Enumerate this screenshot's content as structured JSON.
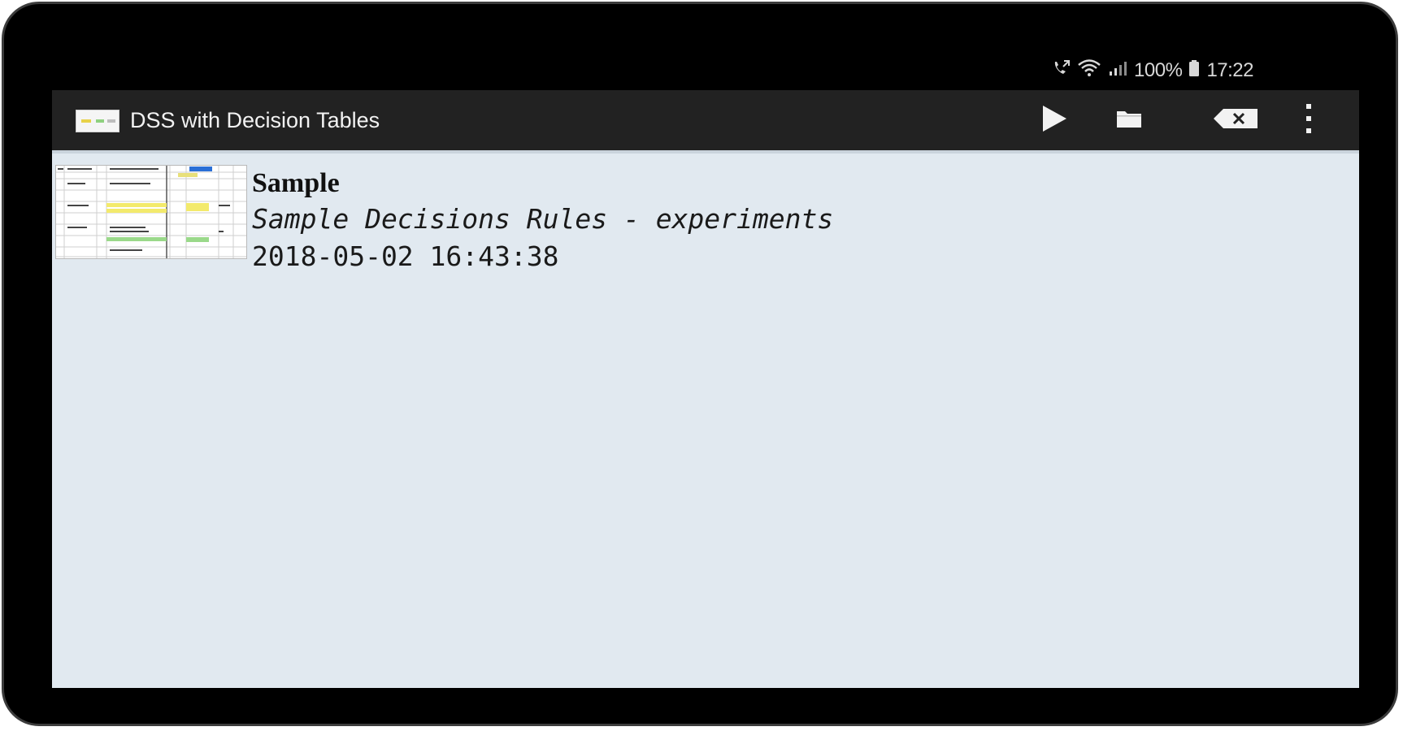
{
  "status_bar": {
    "battery_text": "100%",
    "time": "17:22",
    "icons": [
      "call-forwarding-icon",
      "wifi-icon",
      "signal-icon",
      "battery-icon"
    ]
  },
  "app_bar": {
    "title": "DSS with Decision Tables",
    "actions": [
      {
        "name": "run",
        "icon": "play-icon"
      },
      {
        "name": "open",
        "icon": "folder-icon"
      },
      {
        "name": "clear",
        "icon": "backspace-clear-icon"
      },
      {
        "name": "overflow",
        "icon": "more-vert-icon"
      }
    ]
  },
  "items": [
    {
      "title": "Sample",
      "description": "Sample Decisions Rules - experiments",
      "timestamp": "2018-05-02 16:43:38",
      "thumbnail": "decision-table-preview"
    }
  ],
  "colors": {
    "app_bar_bg": "#222222",
    "content_bg": "#e1e9f0",
    "device_frame": "#000000"
  }
}
